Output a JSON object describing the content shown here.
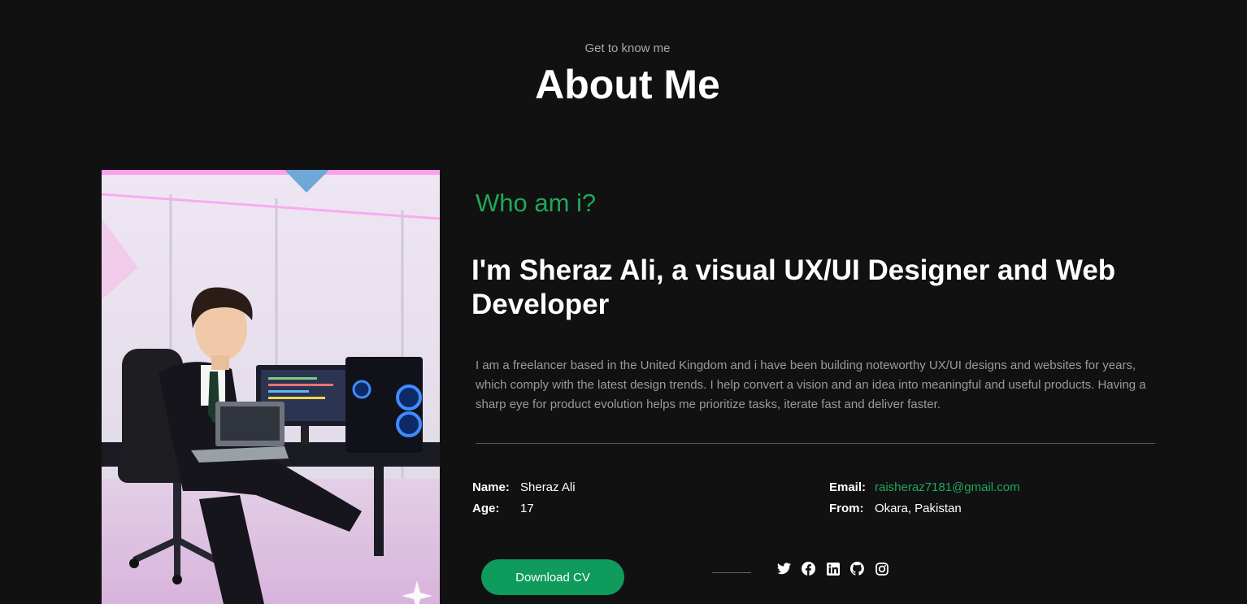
{
  "header": {
    "kicker": "Get to know me",
    "title": "About Me"
  },
  "about": {
    "who": "Who am i?",
    "headline": "I'm Sheraz Ali, a visual UX/UI Designer and Web Developer",
    "bio": "I am a freelancer based in the United Kingdom and i have been building noteworthy UX/UI designs and websites for years, which comply with the latest design trends. I help convert a vision and an idea into meaningful and useful products. Having a sharp eye for product evolution helps me prioritize tasks, iterate fast and deliver faster."
  },
  "info": {
    "name_label": "Name:",
    "name_value": "Sheraz Ali",
    "age_label": "Age:",
    "age_value": "17",
    "email_label": "Email:",
    "email_value": "raisheraz7181@gmail.com",
    "from_label": "From:",
    "from_value": "Okara, Pakistan"
  },
  "actions": {
    "download_cv": "Download CV"
  },
  "socials": [
    {
      "icon": "twitter-icon"
    },
    {
      "icon": "facebook-icon"
    },
    {
      "icon": "linkedin-icon"
    },
    {
      "icon": "github-icon"
    },
    {
      "icon": "instagram-icon"
    }
  ],
  "colors": {
    "background": "#111111",
    "accent": "#1fa85a",
    "button": "#0f9b5c",
    "muted_text": "#9a9a9a"
  }
}
